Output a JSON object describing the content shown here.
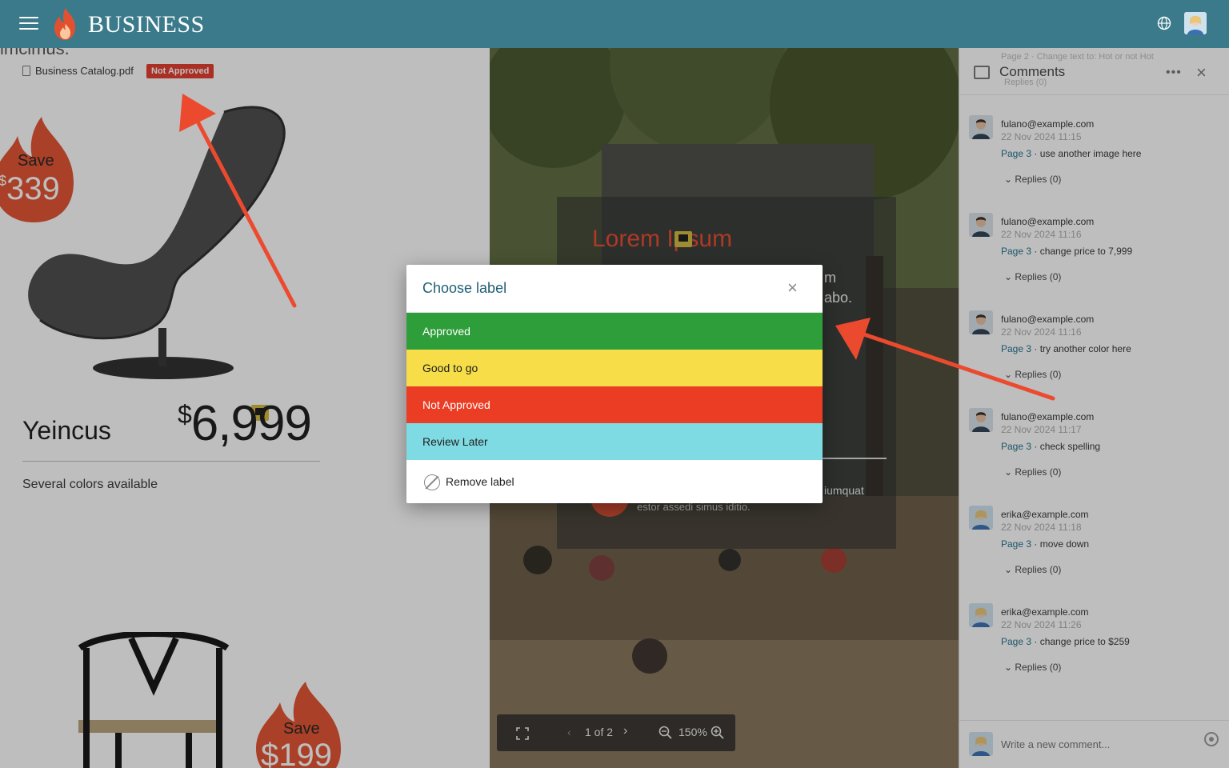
{
  "topbar": {
    "brand": "BUSINESS"
  },
  "document_left": {
    "cut_heading": "imcimus.",
    "file_name": "Business Catalog.pdf",
    "badge": "Not Approved",
    "save_label_1": "Save",
    "save_price_1": "339",
    "product_name": "Yeincus",
    "price_symbol": "$",
    "product_price": "6,999",
    "colors_note": "Several colors available",
    "save_label_2": "Save",
    "save_price_2": "$199"
  },
  "document_right": {
    "title": "Lorem Ipsum",
    "frag_1": "m",
    "frag_2": "abo.",
    "frag_3": "iumquat",
    "frag_4": "estor assedi simus iditio."
  },
  "viewer_toolbar": {
    "page_indicator": "1 of 2",
    "zoom": "150%"
  },
  "comments_panel": {
    "ghost_header": "Page 2 · Change text to: Hot or not Hot",
    "title": "Comments",
    "ghost_replies": "Replies (0)",
    "comments": [
      {
        "author": "fulano@example.com",
        "date": "22 Nov 2024 11:15",
        "page": "Page 3",
        "text": " · use another image here",
        "replies": "Replies (0)"
      },
      {
        "author": "fulano@example.com",
        "date": "22 Nov 2024 11:16",
        "page": "Page 3",
        "text": " · change price to 7,999",
        "replies": "Replies (0)"
      },
      {
        "author": "fulano@example.com",
        "date": "22 Nov 2024 11:16",
        "page": "Page 3",
        "text": " · try another color here",
        "replies": "Replies (0)"
      },
      {
        "author": "fulano@example.com",
        "date": "22 Nov 2024 11:17",
        "page": "Page 3",
        "text": " · check spelling",
        "replies": "Replies (0)"
      },
      {
        "author": "erika@example.com",
        "date": "22 Nov 2024 11:18",
        "page": "Page 3",
        "text": " · move down",
        "replies": "Replies (0)"
      },
      {
        "author": "erika@example.com",
        "date": "22 Nov 2024 11:26",
        "page": "Page 3",
        "text": " · change price to $259",
        "replies": "Replies (0)"
      }
    ],
    "new_comment_placeholder": "Write a new comment..."
  },
  "modal": {
    "title": "Choose label",
    "options": [
      {
        "label": "Approved",
        "color": "#2e9e3a",
        "text_color": "#ffffff"
      },
      {
        "label": "Good to go",
        "color": "#f7dd47",
        "text_color": "#222222"
      },
      {
        "label": "Not Approved",
        "color": "#ea3d23",
        "text_color": "#ffffff"
      },
      {
        "label": "Review Later",
        "color": "#7fdbe3",
        "text_color": "#222222"
      }
    ],
    "remove_label": "Remove label"
  },
  "colors": {
    "topbar": "#3a7a8a",
    "accent_red": "#e33b2b",
    "link": "#1f6f8b"
  }
}
